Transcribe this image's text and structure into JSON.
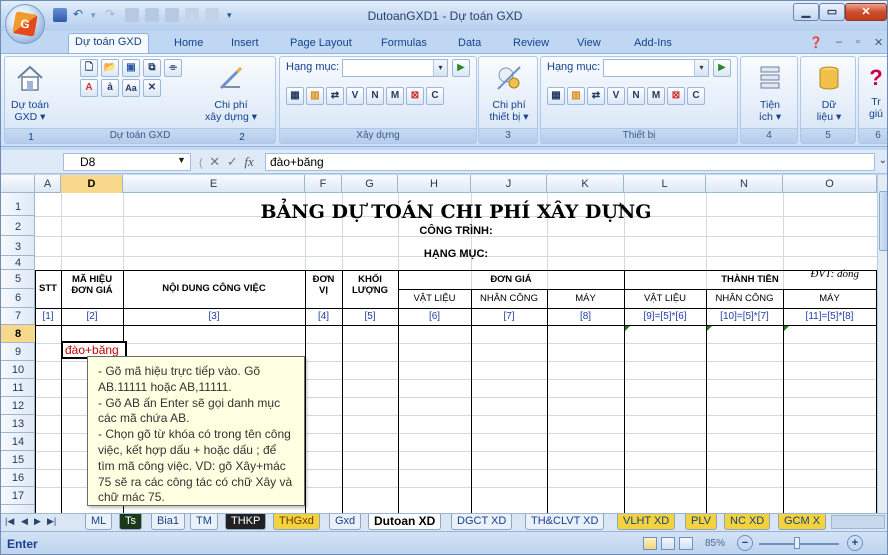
{
  "window": {
    "title": "DutoanGXD1 - Dự toán GXD",
    "office_logo": "G"
  },
  "tabs": [
    "Dự toán GXD",
    "Home",
    "Insert",
    "Page Layout",
    "Formulas",
    "Data",
    "Review",
    "View",
    "Add-Ins"
  ],
  "ribbon": {
    "dutoan_btn": [
      "Dự toán",
      "GXD ▾"
    ],
    "chiphi_xaydung": [
      "Chi phí",
      "xây dựng ▾"
    ],
    "chiphi_thietbi": [
      "Chi phí",
      "thiết bị ▾"
    ],
    "hangmuc_label": "Hạng mục:",
    "hangmuc_label2": "Hạng mục:",
    "letters": [
      "V",
      "N",
      "M",
      "C"
    ],
    "tien_ich": [
      "Tiện",
      "ích ▾"
    ],
    "du_lieu": [
      "Dữ",
      "liệu ▾"
    ],
    "tr_giu": [
      "Tr",
      "giú"
    ],
    "groups": [
      "Dự toán GXD",
      "Xây dựng",
      "Thiết bị"
    ],
    "group_nums": [
      "1",
      "2",
      "3",
      "4",
      "5",
      "6"
    ]
  },
  "formula_bar": {
    "name_box": "D8",
    "formula": "đào+băng",
    "fx": "fx"
  },
  "columns": [
    "A",
    "D",
    "E",
    "F",
    "G",
    "H",
    "J",
    "K",
    "L",
    "N",
    "O"
  ],
  "rows": [
    "1",
    "2",
    "3",
    "4",
    "5",
    "6",
    "7",
    "8",
    "9",
    "10",
    "11",
    "12",
    "13",
    "14",
    "15",
    "16",
    "17"
  ],
  "sheet": {
    "title": "BẢNG DỰ TOÁN CHI PHÍ XÂY DỰNG",
    "cong_trinh": "CÔNG TRÌNH:",
    "hang_muc": "HẠNG MỤC:",
    "dvt": "ĐVT: đồng",
    "headers": {
      "stt": "STT",
      "ma_hieu": [
        "MÃ HIỆU",
        "ĐƠN GIÁ"
      ],
      "noi_dung": "NỘI DUNG CÔNG VIỆC",
      "don_vi": [
        "ĐƠN",
        "VỊ"
      ],
      "khoi_luong": [
        "KHỐI",
        "LƯỢNG"
      ],
      "don_gia": "ĐƠN GIÁ",
      "thanh_tien": "THÀNH TIỀN",
      "vat_lieu": "VẬT LIỆU",
      "nhan_cong": "NHÂN CÔNG",
      "may": "MÁY",
      "vat_lieu2": "VẬT LIỆU",
      "nhan_cong2": "NHÂN CÔNG",
      "may2": "MÁY"
    },
    "index_row": [
      "[1]",
      "[2]",
      "[3]",
      "[4]",
      "[5]",
      "[6]",
      "[7]",
      "[8]",
      "[9]=[5]*[6]",
      "[10]=[5]*[7]",
      "[11]=[5]*[8]"
    ],
    "active_cell_value": "đào+băng"
  },
  "tooltip": [
    "- Gõ mã hiệu trực tiếp vào. Gõ",
    "AB.11111 hoặc AB,11111.",
    "- Gõ AB ấn Enter sẽ gọi danh mục",
    "các mã chứa AB.",
    "- Chọn gõ từ khóa có trong tên công",
    "việc, kết hợp dấu + hoặc dấu ; để",
    "tìm mã công việc. VD: gõ Xây+mác",
    "75 sẽ ra các công tác có chữ Xây và",
    "chữ mác 75."
  ],
  "sheet_tabs": [
    {
      "label": "ML",
      "color": "#eaf1fa"
    },
    {
      "label": "Ts",
      "color": "#1a3a1a"
    },
    {
      "label": "Bia1",
      "color": "#eaf1fa"
    },
    {
      "label": "TM",
      "color": "#eaf1fa"
    },
    {
      "label": "THKP",
      "color": "#222"
    },
    {
      "label": "THGxd",
      "color": "#f3d23c"
    },
    {
      "label": "Gxd",
      "color": "#eaf1fa"
    },
    {
      "label": "Dutoan XD",
      "color": "#ffffff"
    },
    {
      "label": "DGCT XD",
      "color": "#eaf1fa"
    },
    {
      "label": "TH&CLVT XD",
      "color": "#eaf1fa"
    },
    {
      "label": "VLHT XD",
      "color": "#f3d23c"
    },
    {
      "label": "PLV",
      "color": "#f3d23c"
    },
    {
      "label": "NC XD",
      "color": "#f3d23c"
    },
    {
      "label": "GCM X",
      "color": "#f3d23c"
    }
  ],
  "status": {
    "mode": "Enter",
    "zoom": "85%",
    "zoom_minus": "−",
    "zoom_plus": "+"
  },
  "colors": {
    "accent": "#15428b",
    "active_header": "#f8d88a",
    "tooltip_bg": "#ffffe1",
    "cell_text_red": "#c00000"
  }
}
